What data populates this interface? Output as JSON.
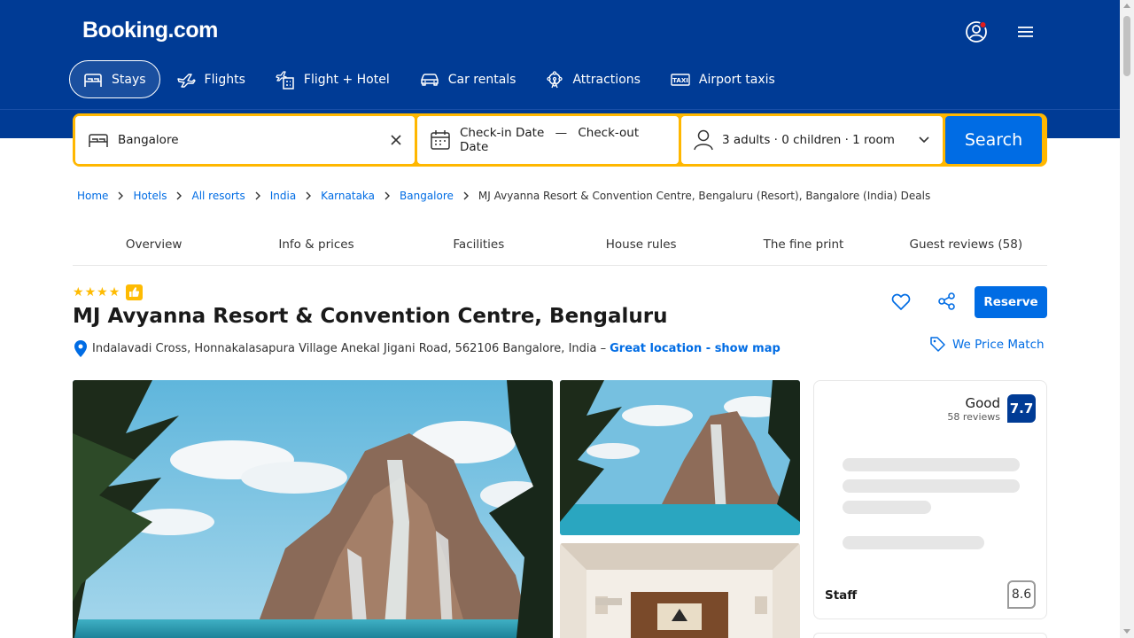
{
  "header": {
    "logo": "Booking.com",
    "account_icon": "account-icon",
    "menu_icon": "hamburger-menu-icon",
    "brand_color": "#003b95"
  },
  "nav": {
    "items": [
      {
        "label": "Stays",
        "icon": "bed-icon",
        "active": true
      },
      {
        "label": "Flights",
        "icon": "plane-icon"
      },
      {
        "label": "Flight + Hotel",
        "icon": "plane-hotel-icon"
      },
      {
        "label": "Car rentals",
        "icon": "car-icon"
      },
      {
        "label": "Attractions",
        "icon": "ferris-wheel-icon"
      },
      {
        "label": "Airport taxis",
        "icon": "taxi-icon"
      }
    ]
  },
  "search": {
    "destination": "Bangalore",
    "checkin": "Check-in Date",
    "dash": "—",
    "checkout": "Check-out Date",
    "guests": "3 adults · 0 children · 1 room",
    "button": "Search",
    "accent": "#ffb700",
    "button_color": "#006ce4"
  },
  "breadcrumb": {
    "items": [
      "Home",
      "Hotels",
      "All resorts",
      "India",
      "Karnataka",
      "Bangalore"
    ],
    "current": "MJ Avyanna Resort & Convention Centre, Bengaluru (Resort), Bangalore (India) Deals"
  },
  "tabs": [
    "Overview",
    "Info & prices",
    "Facilities",
    "House rules",
    "The fine print",
    "Guest reviews (58)"
  ],
  "hotel": {
    "stars": 4,
    "name": "MJ Avyanna Resort & Convention Centre, Bengaluru",
    "address": "Indalavadi Cross, Honnakalasapura Village Anekal Jigani Road, 562106 Bangalore, India –",
    "location_link": "Great location - show map",
    "reserve": "Reserve",
    "price_match": "We Price Match"
  },
  "review": {
    "rating_word": "Good",
    "count": "58 reviews",
    "score": "7.7",
    "staff_label": "Staff",
    "staff_score": "8.6"
  }
}
